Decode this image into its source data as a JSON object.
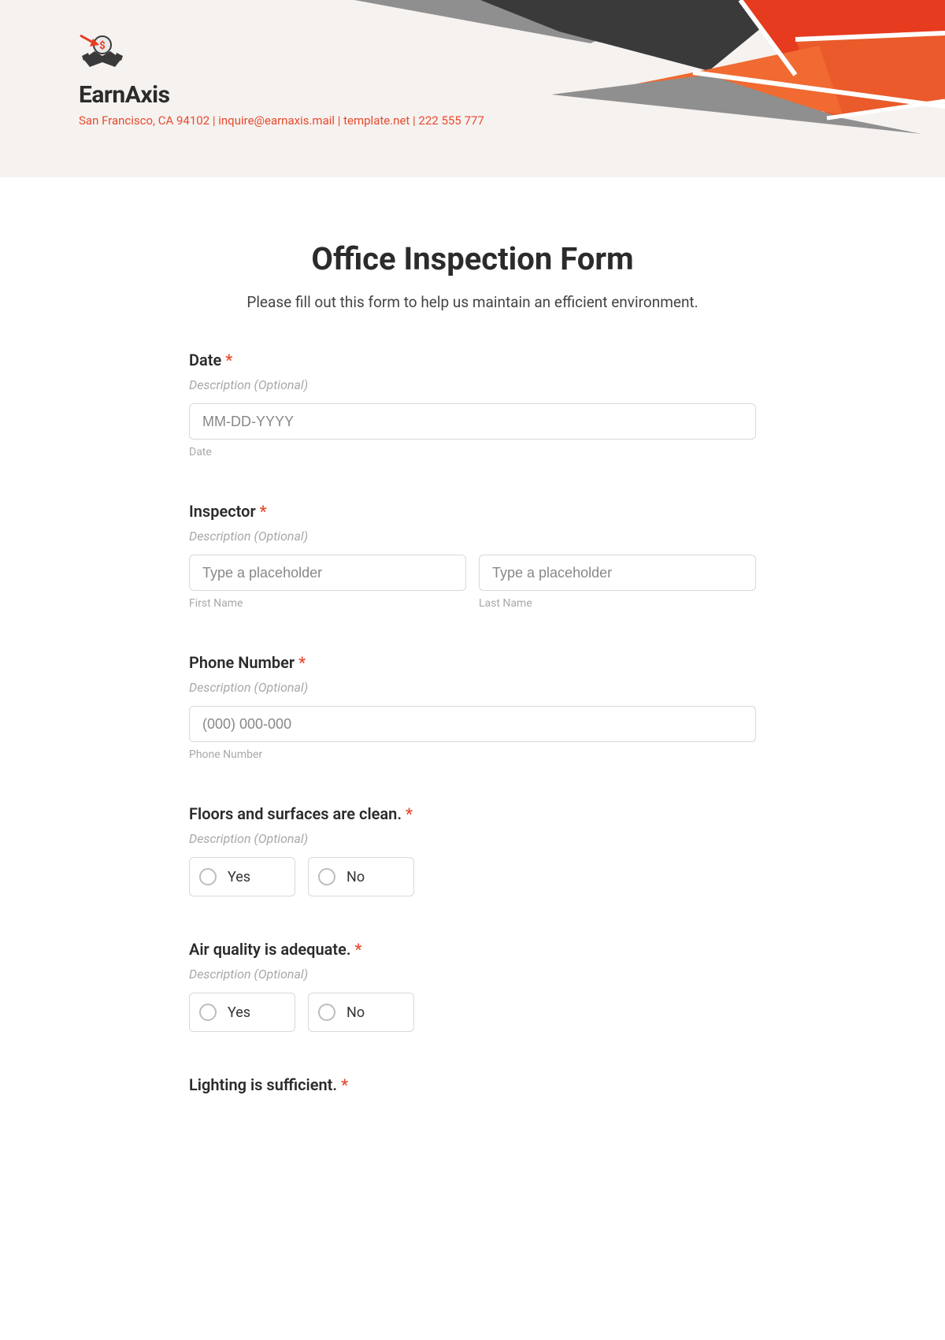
{
  "brand": {
    "name": "EarnAxis",
    "contact": "San Francisco, CA 94102 | inquire@earnaxis.mail | template.net | 222 555 777"
  },
  "form": {
    "title": "Office Inspection Form",
    "subtitle": "Please fill out this form to help us maintain an efficient environment.",
    "required_marker": "*",
    "desc_placeholder": "Description (Optional)",
    "fields": {
      "date": {
        "label": "Date",
        "placeholder": "MM-DD-YYYY",
        "sublabel": "Date"
      },
      "inspector": {
        "label": "Inspector",
        "first_placeholder": "Type a placeholder",
        "last_placeholder": "Type a placeholder",
        "first_sublabel": "First Name",
        "last_sublabel": "Last Name"
      },
      "phone": {
        "label": "Phone Number",
        "placeholder": "(000) 000-000",
        "sublabel": "Phone Number"
      },
      "floors": {
        "label": "Floors and surfaces are clean.",
        "yes": "Yes",
        "no": "No"
      },
      "air": {
        "label": "Air quality is adequate.",
        "yes": "Yes",
        "no": "No"
      },
      "lighting": {
        "label": "Lighting is sufficient."
      }
    }
  }
}
